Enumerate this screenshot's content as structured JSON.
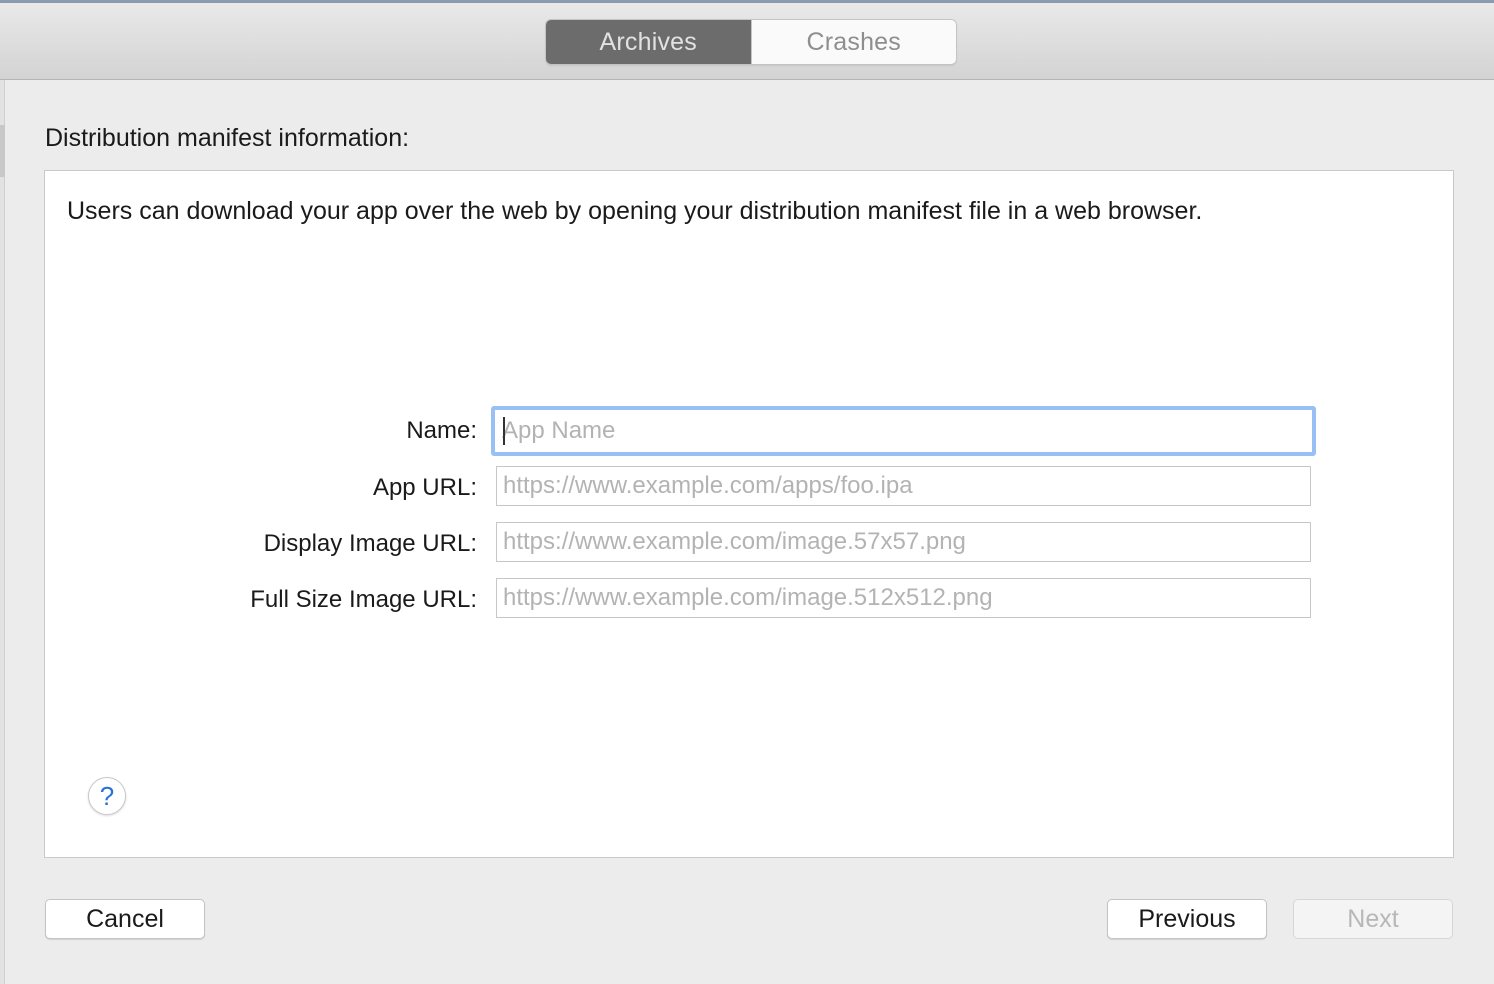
{
  "tabs": [
    {
      "label": "Archives",
      "active": true
    },
    {
      "label": "Crashes",
      "active": false
    }
  ],
  "section_title": "Distribution manifest information:",
  "description": "Users can download your app over the web by opening your distribution manifest file in a web browser.",
  "fields": [
    {
      "label": "Name:",
      "value": "",
      "placeholder": "App Name",
      "focused": true
    },
    {
      "label": "App URL:",
      "value": "",
      "placeholder": "https://www.example.com/apps/foo.ipa"
    },
    {
      "label": "Display Image URL:",
      "value": "",
      "placeholder": "https://www.example.com/image.57x57.png"
    },
    {
      "label": "Full Size Image URL:",
      "value": "",
      "placeholder": "https://www.example.com/image.512x512.png"
    }
  ],
  "help": {
    "glyph": "?"
  },
  "buttons": {
    "cancel": "Cancel",
    "previous": "Previous",
    "next": "Next"
  },
  "colors": {
    "focus_ring": "#99c0f5",
    "active_tab": "#6c6c6c",
    "help_glyph": "#2a6fdb"
  }
}
